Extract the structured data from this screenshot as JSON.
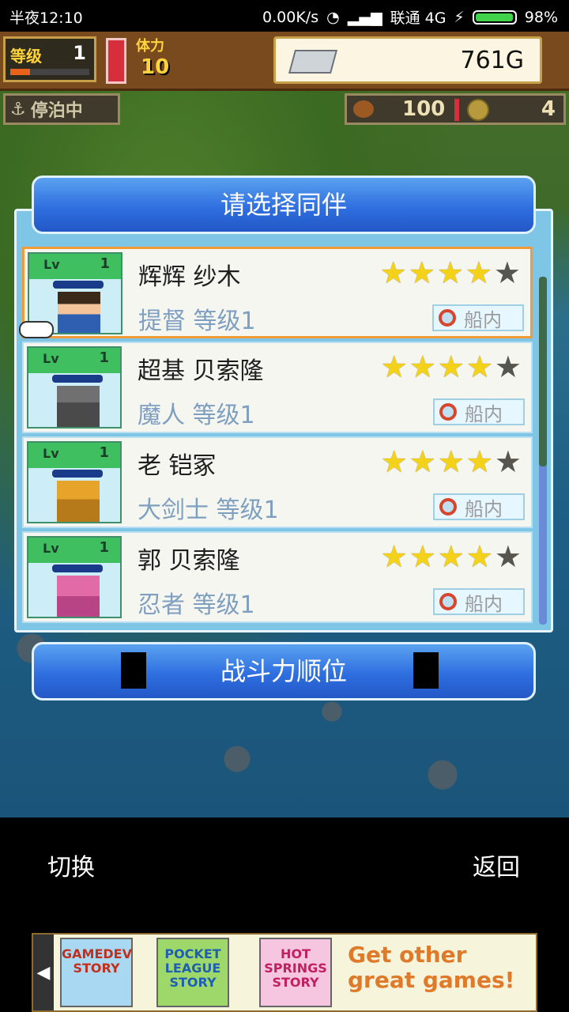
{
  "status_bar": {
    "time": "半夜12:10",
    "net_speed": "0.00K/s",
    "carrier": "联通 4G",
    "battery": "98%",
    "battery_level": 0.98
  },
  "hud": {
    "level_label": "等级",
    "level_value": "1",
    "stamina_label": "体力",
    "stamina_value": "10",
    "money": "761G",
    "dock_status": "停泊中",
    "food": "100",
    "coins": "4"
  },
  "dialog": {
    "title": "请选择同伴",
    "members": [
      {
        "lv_label": "Lv",
        "lv": "1",
        "name": "辉辉 纱木",
        "job": "提督 等级1",
        "stars": 4,
        "location": "船内",
        "selected": true
      },
      {
        "lv_label": "Lv",
        "lv": "1",
        "name": "超基 贝索隆",
        "job": "魔人 等级1",
        "stars": 4,
        "location": "船内",
        "selected": false
      },
      {
        "lv_label": "Lv",
        "lv": "1",
        "name": "老 铠冢",
        "job": "大剑士 等级1",
        "stars": 4,
        "location": "船内",
        "selected": false
      },
      {
        "lv_label": "Lv",
        "lv": "1",
        "name": "郭 贝索隆",
        "job": "忍者 等级1",
        "stars": 4,
        "location": "船内",
        "selected": false
      }
    ],
    "rank_button": "战斗力顺位"
  },
  "bottom_bar": {
    "switch_label": "切换",
    "back_label": "返回"
  },
  "ad": {
    "games": [
      "GAMEDEV STORY",
      "POCKET LEAGUE STORY",
      "HOT SPRINGS STORY"
    ],
    "cta": "Get other great games!"
  }
}
